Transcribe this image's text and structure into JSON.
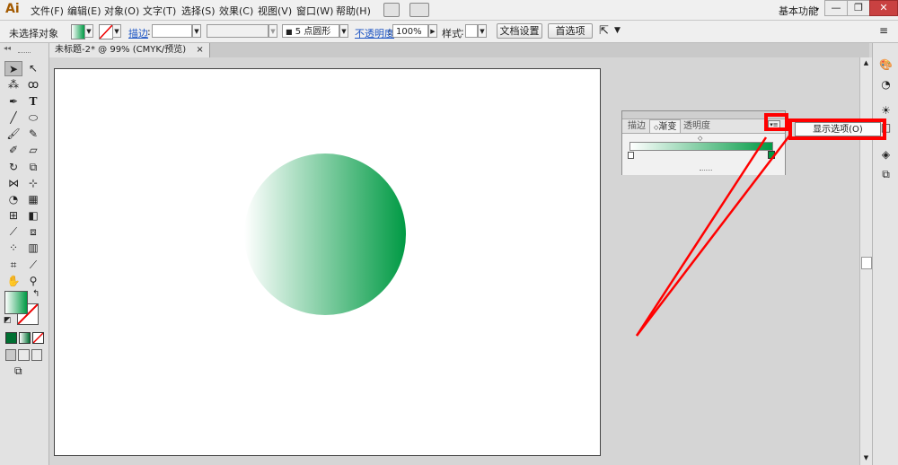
{
  "app": {
    "logo": "Ai",
    "menus": [
      "文件(F)",
      "编辑(E)",
      "对象(O)",
      "文字(T)",
      "选择(S)",
      "效果(C)",
      "视图(V)",
      "窗口(W)",
      "帮助(H)"
    ],
    "workspace": "基本功能",
    "window_buttons": [
      "—",
      "❐",
      "✕"
    ]
  },
  "control_bar": {
    "selection_status": "未选择对象",
    "stroke_label": "描边",
    "brush_value": "5 点圆形",
    "opacity_label": "不透明度",
    "opacity_value": "100%",
    "style_label": "样式",
    "doc_settings_button": "文档设置",
    "preferences_button": "首选项"
  },
  "document": {
    "tab_title": "未标题-2* @ 99% (CMYK/预览)",
    "tab_close": "×"
  },
  "colors": {
    "gradient_start": "#ffffff",
    "gradient_end": "#009a44",
    "highlight": "#ff0000"
  },
  "gradient_panel": {
    "tabs": [
      "描边",
      "渐变",
      "透明度"
    ],
    "active_tab": "渐变",
    "menu_item": "显示选项(O)"
  }
}
